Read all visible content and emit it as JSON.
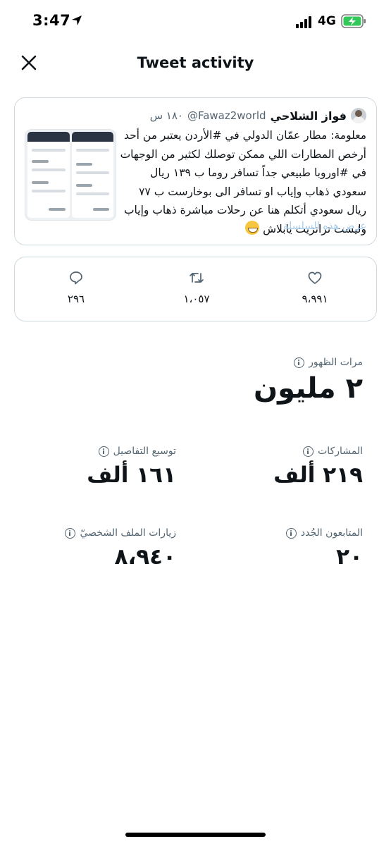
{
  "status_bar": {
    "time": "3:47",
    "network": "4G"
  },
  "header": {
    "title": "Tweet activity"
  },
  "tweet": {
    "author_name": "فواز الشلاحي",
    "author_handle": "@Fawaz2world",
    "time": "١٨٠ س",
    "text": "معلومة: مطار عمّان الدولي في #الأردن يعتبر من أحد أرخص المطارات اللي ممكن توصلك لكثير من الوجهات في #اوروبا طبيعي جداً تسافر روما ب ١٣٩ ريال سعودي ذهاب وإياب او تسافر الى بوخارست ب ٧٧ ريال سعودي أتكلم هنا عن رحلات مباشرة ذهاب وإياب وليست ترانزيت يابلاش",
    "emoji": "grinning-face-emoji",
    "show_thread": "عرض هذه السلسلة"
  },
  "engagement": {
    "replies": "٢٩٦",
    "retweets": "١،٠٥٧",
    "likes": "٩،٩٩١"
  },
  "metrics": {
    "impressions": {
      "label": "مرات الظهور",
      "value": "٢ مليون"
    },
    "engagements": {
      "label": "المشاركات",
      "value": "٢١٩ ألف"
    },
    "detail_expands": {
      "label": "توسيع التفاصيل",
      "value": "١٦١ ألف"
    },
    "new_followers": {
      "label": "المتابعون الجُدد",
      "value": "٢٠"
    },
    "profile_visits": {
      "label": "زيارات الملف الشخصيّ",
      "value": "٨،٩٤٠"
    }
  },
  "colors": {
    "text": "#0f1419",
    "secondary": "#536471",
    "border": "#cfd9de",
    "link": "#a7cdee",
    "battery": "#34c759"
  }
}
